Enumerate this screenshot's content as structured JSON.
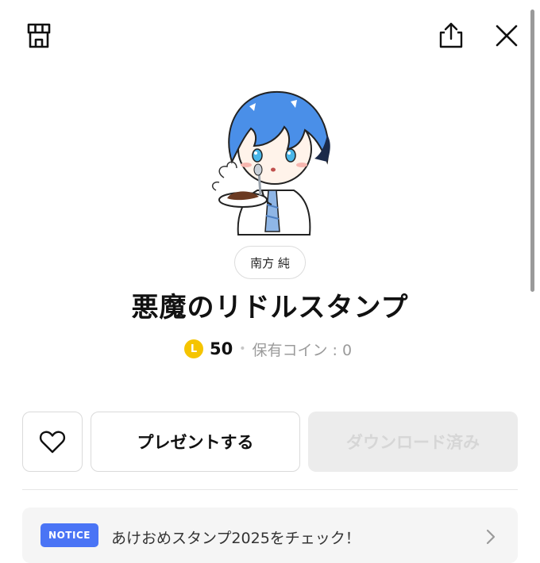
{
  "topbar": {
    "shop_icon": "shop-icon",
    "share_icon": "share-icon",
    "close_icon": "close-icon"
  },
  "sticker": {
    "image": "sticker-character-eating-curry"
  },
  "author": "南方 純",
  "title": "悪魔のリドルスタンプ",
  "price": {
    "coin_glyph": "L",
    "amount": "50",
    "separator": "•",
    "owned_coins": "保有コイン : 0"
  },
  "actions": {
    "favorite_icon": "heart-icon",
    "gift_label": "プレゼントする",
    "download_label": "ダウンロード済み"
  },
  "notice": {
    "badge": "NOTICE",
    "text": "あけおめスタンプ2025をチェック！",
    "chevron_icon": "chevron-right-icon"
  },
  "colors": {
    "coin": "#f5c400",
    "notice_badge": "#4a74f5",
    "disabled_button": "#ececec"
  }
}
